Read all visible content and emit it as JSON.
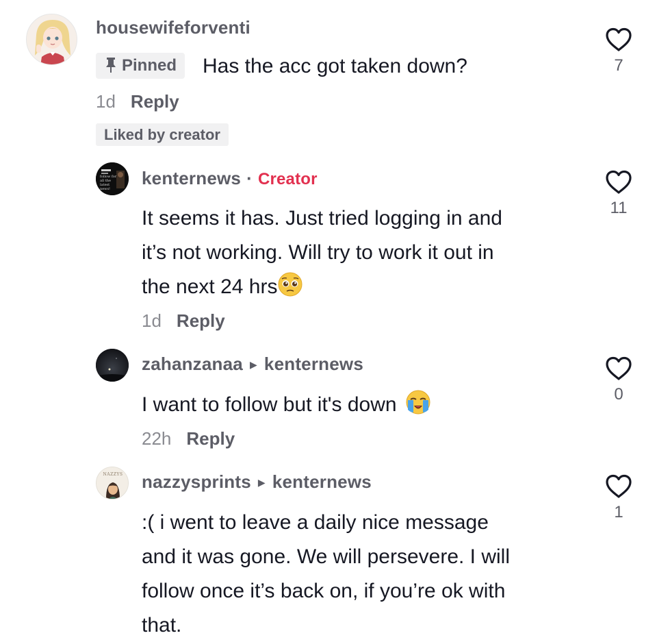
{
  "comments": [
    {
      "username": "housewifeforventi",
      "pinned_label": "Pinned",
      "text": "Has the acc got taken down?",
      "time": "1d",
      "reply_label": "Reply",
      "liked_badge": "Liked by creator",
      "likes": "7",
      "avatar_icon": "anime-girl-avatar"
    },
    {
      "username": "kenternews",
      "separator": "·",
      "creator_label": "Creator",
      "text_lines": [
        "It seems it has. Just tried logging in and",
        "it’s not working. Will try to work it out in",
        "the next 24 hrs"
      ],
      "emoji": "pleading-face-emoji",
      "time": "1d",
      "reply_label": "Reply",
      "likes": "11",
      "avatar_text": [
        "follow for",
        "all the",
        "latest news!"
      ]
    },
    {
      "username": "zahanzanaa",
      "reply_to": "kenternews",
      "text": "I want to follow but it's down",
      "emoji": "loudly-crying-face-emoji",
      "time": "22h",
      "reply_label": "Reply",
      "likes": "0",
      "avatar_icon": "night-sky-avatar"
    },
    {
      "username": "nazzysprints",
      "reply_to": "kenternews",
      "text_lines": [
        ":( i went to leave a daily nice message",
        "and it was gone. We will persevere. I will",
        "follow once it’s back on, if you’re ok with",
        "that."
      ],
      "likes": "1",
      "avatar_text": "NAZZYS"
    }
  ],
  "colors": {
    "creator": "#e2304f",
    "username": "#5c5d66",
    "text": "#161823",
    "meta": "#8a8b91",
    "badge_bg": "#f1f1f2"
  }
}
